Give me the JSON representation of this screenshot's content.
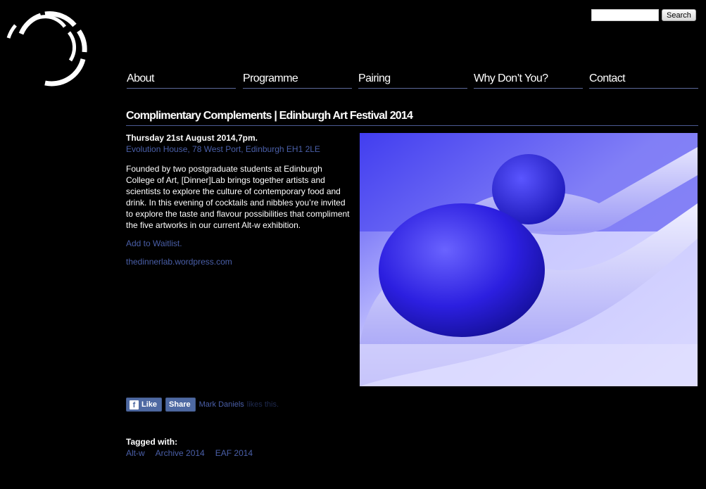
{
  "search": {
    "placeholder": "",
    "value": "",
    "button_label": "Search"
  },
  "nav": [
    "About",
    "Programme",
    "Pairing",
    "Why Don’t You?",
    "Contact"
  ],
  "page_title": "Complimentary Complements | Edinburgh Art Festival 2014",
  "event": {
    "date": "Thursday 21st August 2014,7pm.",
    "venue": "Evolution House, 78 West Port, Edinburgh EH1 2LE",
    "description": "Founded by two postgraduate students at Edinburgh College of Art, [Dinner]Lab brings together artists and scientists to explore the culture of contemporary food and drink. In this evening of cocktails and nibbles you’re invited to explore the taste and flavour possibilities that compliment the five artworks in our current Alt-w exhibition.",
    "waitlist_link": "Add to Waitlist.",
    "website_link": "thedinnerlab.wordpress.com"
  },
  "social": {
    "like_label": "Like",
    "share_label": "Share",
    "liker_name": "Mark Daniels",
    "likes_suffix": "likes this."
  },
  "tags": {
    "label": "Tagged with:",
    "items": [
      "Alt-w",
      "Archive 2014",
      "EAF 2014"
    ]
  },
  "colors": {
    "background": "#000000",
    "link": "#4a5fa8",
    "nav_rule": "#5e6a9c",
    "facebook": "#4e69a2",
    "photo_tint": "#2a25f0"
  },
  "icons": {
    "logo": "segmented-ring-logo",
    "facebook": "facebook-f-icon"
  }
}
